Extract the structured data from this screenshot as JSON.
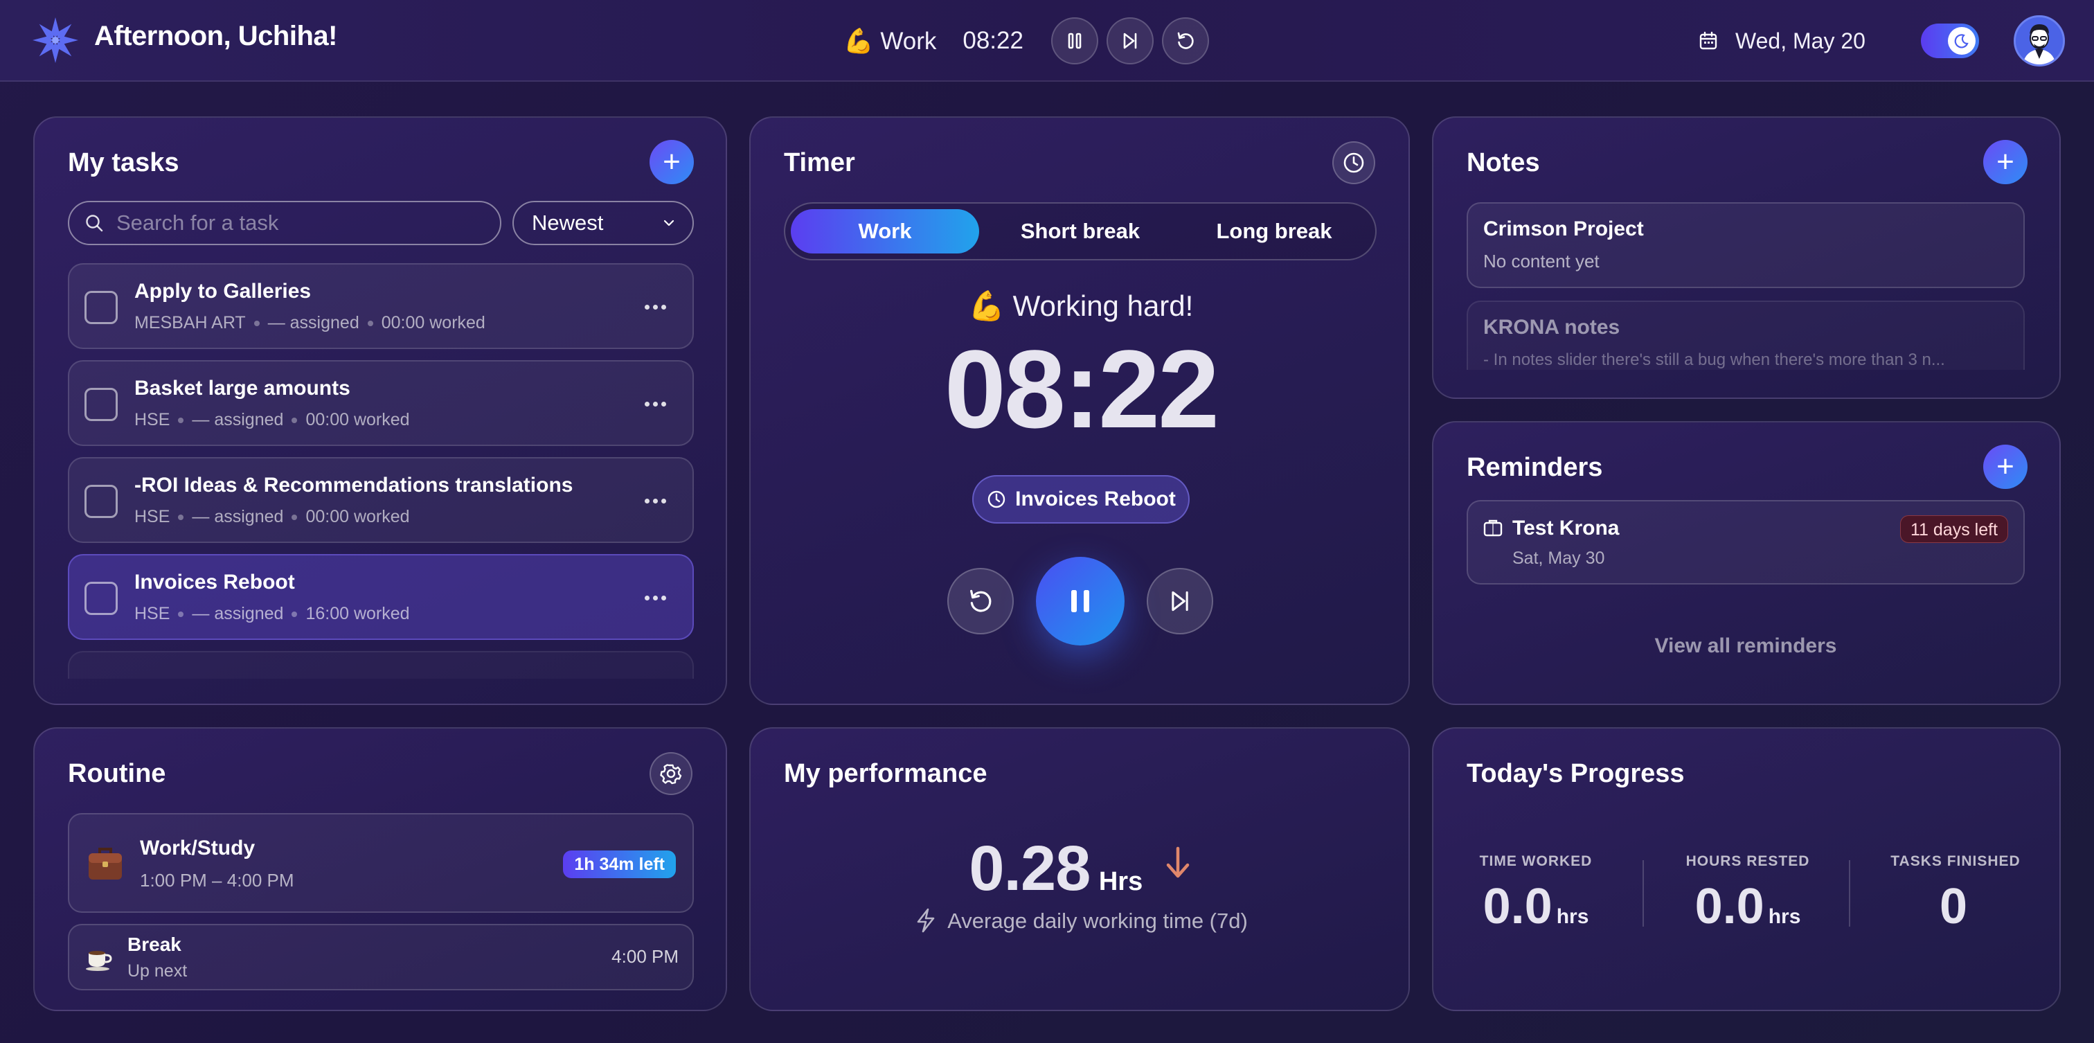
{
  "header": {
    "greeting": "Afternoon, Uchiha!",
    "mode_emoji": "💪",
    "mode": "Work",
    "time": "08:22",
    "date": "Wed, May 20"
  },
  "tasks": {
    "title": "My tasks",
    "search_placeholder": "Search for a task",
    "sort": "Newest",
    "items": [
      {
        "title": "Apply to Galleries",
        "project": "MESBAH ART",
        "assigned": "— assigned",
        "worked": "00:00 worked"
      },
      {
        "title": "Basket large amounts",
        "project": "HSE",
        "assigned": "— assigned",
        "worked": "00:00 worked"
      },
      {
        "title": "-ROI Ideas & Recommendations translations",
        "project": "HSE",
        "assigned": "— assigned",
        "worked": "00:00 worked"
      },
      {
        "title": "Invoices Reboot",
        "project": "HSE",
        "assigned": "— assigned",
        "worked": "16:00 worked"
      }
    ]
  },
  "timer": {
    "title": "Timer",
    "tabs": [
      "Work",
      "Short break",
      "Long break"
    ],
    "status": "💪 Working hard!",
    "time": "08:22",
    "current_task": "Invoices Reboot"
  },
  "notes": {
    "title": "Notes",
    "items": [
      {
        "title": "Crimson Project",
        "content": "No content yet"
      },
      {
        "title": "KRONA notes",
        "content": "- In notes slider there's still a bug when there's more than 3 n..."
      }
    ]
  },
  "reminders": {
    "title": "Reminders",
    "items": [
      {
        "title": "Test Krona",
        "date": "Sat, May 30",
        "badge": "11 days left"
      }
    ],
    "view_all": "View all reminders"
  },
  "routine": {
    "title": "Routine",
    "current": {
      "title": "Work/Study",
      "time": "1:00 PM – 4:00 PM",
      "badge": "1h 34m left"
    },
    "next": {
      "title": "Break",
      "subtitle": "Up next",
      "time": "4:00 PM"
    }
  },
  "performance": {
    "title": "My performance",
    "value": "0.28",
    "unit": "Hrs",
    "caption": "Average daily working time (7d)",
    "trend": "down"
  },
  "progress": {
    "title": "Today's Progress",
    "stats": [
      {
        "label": "TIME WORKED",
        "value": "0.0",
        "unit": "hrs"
      },
      {
        "label": "HOURS RESTED",
        "value": "0.0",
        "unit": "hrs"
      },
      {
        "label": "TASKS FINISHED",
        "value": "0",
        "unit": ""
      }
    ]
  },
  "colors": {
    "accent_purple": "#5b3ef0",
    "accent_blue": "#21a3ec",
    "trend_down": "#e0876b",
    "badge_red": "#4a1628"
  }
}
